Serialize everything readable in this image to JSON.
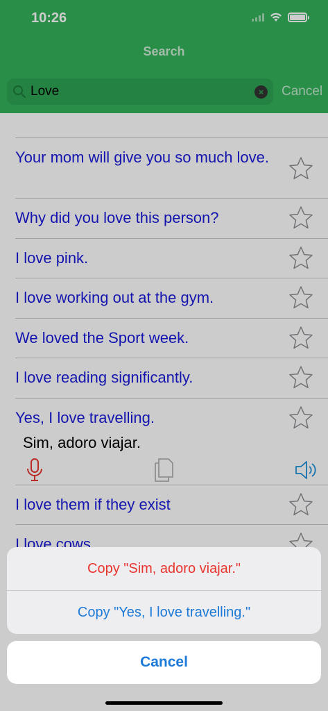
{
  "status_bar": {
    "time": "10:26"
  },
  "nav": {
    "title": "Search"
  },
  "search": {
    "query": "Love",
    "cancel_label": "Cancel"
  },
  "colors": {
    "accent_green": "#33b25a",
    "phrase_blue": "#1a1adb",
    "destructive_red": "#e8362f",
    "action_blue": "#1c7ad8"
  },
  "results": [
    {
      "text": "Your mom will give you so much love."
    },
    {
      "text": "Why did you love this person?"
    },
    {
      "text": "I love pink."
    },
    {
      "text": "I love working out at the gym."
    },
    {
      "text": "We loved the Sport week."
    },
    {
      "text": "I love reading significantly."
    },
    {
      "text": "Yes, I love travelling.",
      "translation": "Sim, adoro viajar.",
      "expanded": true
    },
    {
      "text": "I love them if they exist"
    },
    {
      "text": "I love cows."
    }
  ],
  "action_sheet": {
    "copy_translation": "Copy \"Sim, adoro viajar.\"",
    "copy_original": "Copy \"Yes, I love travelling.\"",
    "cancel": "Cancel"
  },
  "icons": [
    "search-icon",
    "clear-icon",
    "star-icon",
    "microphone-icon",
    "copy-icon",
    "speaker-icon"
  ]
}
